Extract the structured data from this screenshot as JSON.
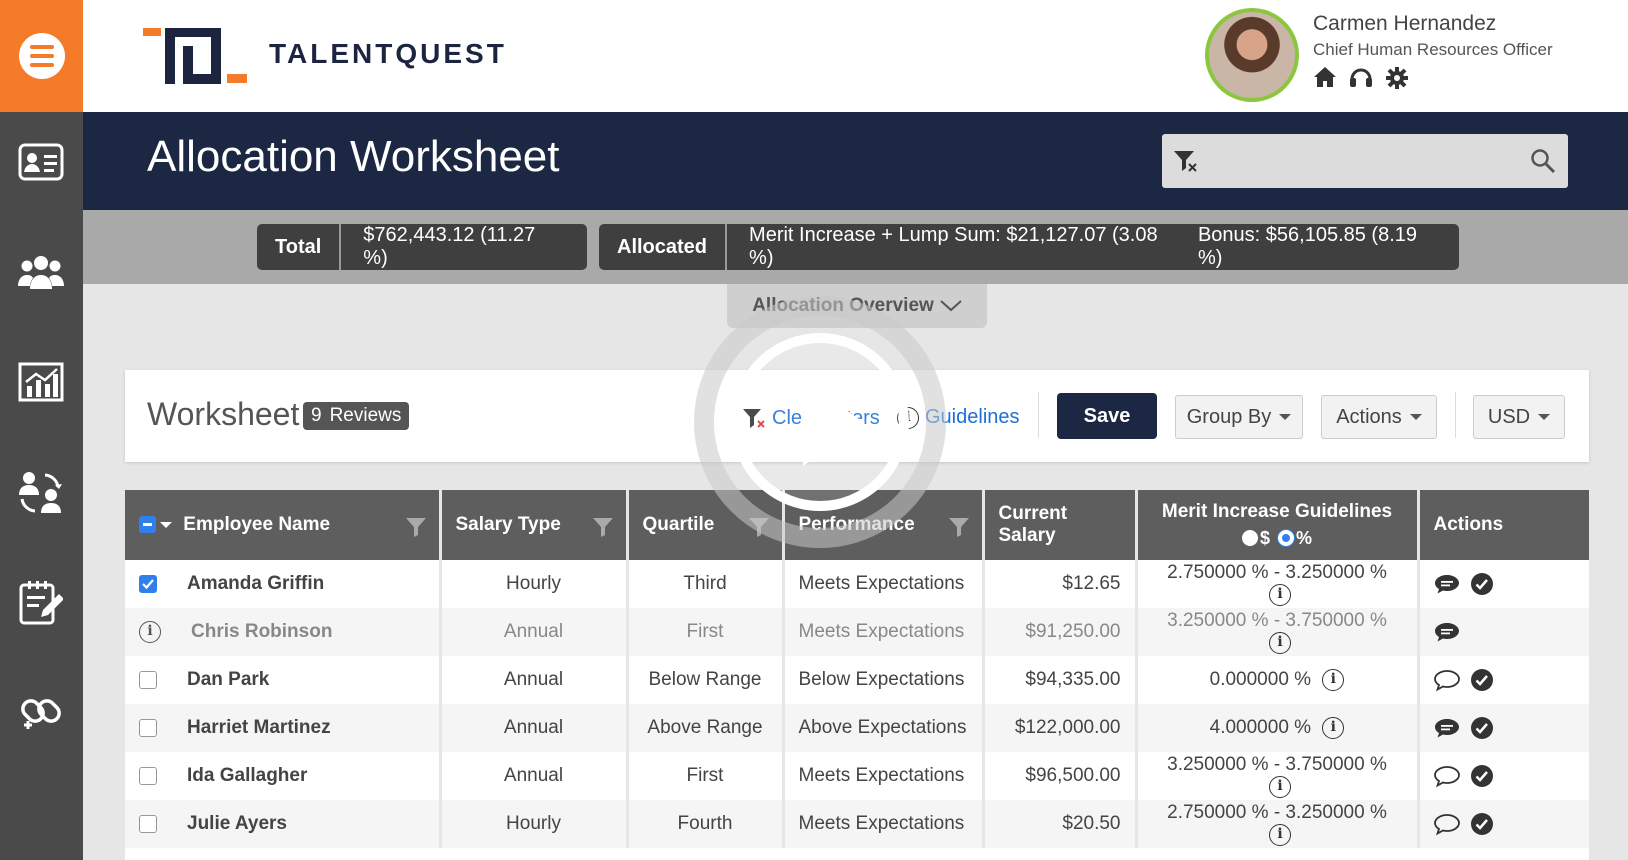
{
  "app": {
    "brand": "TALENTQUEST",
    "colors": {
      "brand_orange": "#f47b2a",
      "navy": "#1c2744",
      "link_blue": "#1e6fd9",
      "avatar_ring": "#8cc63f"
    }
  },
  "user": {
    "name": "Carmen Hernandez",
    "role": "Chief Human Resources Officer",
    "icons": [
      "home-icon",
      "headset-icon",
      "gear-icon"
    ]
  },
  "sidebar": {
    "items": [
      {
        "icon": "employee-card-icon"
      },
      {
        "icon": "people-group-icon"
      },
      {
        "icon": "chart-icon"
      },
      {
        "icon": "people-sync-icon"
      },
      {
        "icon": "edit-document-icon"
      },
      {
        "icon": "link-icon"
      }
    ]
  },
  "page": {
    "title": "Allocation Worksheet",
    "search_placeholder": ""
  },
  "summary": {
    "total_label": "Total",
    "total_value": "$762,443.12 (11.27 %)",
    "allocated_label": "Allocated",
    "merit_value": "Merit Increase + Lump Sum: $21,127.07 (3.08 %)",
    "bonus_value": "Bonus: $56,105.85 (8.19 %)",
    "overview_label": "Allocation Overview"
  },
  "worksheet": {
    "title": "Worksheet",
    "badge_count": "9",
    "badge_label": "Reviews",
    "clear_filters_label": "Clear Filters",
    "guidelines_label": "Guidelines",
    "save_label": "Save",
    "group_by_label": "Group By",
    "actions_label": "Actions",
    "currency_label": "USD"
  },
  "table": {
    "headers": {
      "employee_name": "Employee Name",
      "salary_type": "Salary Type",
      "quartile": "Quartile",
      "performance": "Performance",
      "current_salary": "Current Salary",
      "merit_guidelines": "Merit Increase Guidelines",
      "toggle_dollar": "$",
      "toggle_percent": "%",
      "actions": "Actions"
    },
    "rows": [
      {
        "name": "Amanda Griffin",
        "salary_type": "Hourly",
        "quartile": "Third",
        "performance": "Meets Expectations",
        "current_salary": "$12.65",
        "guideline": "2.750000 % - 3.250000 %",
        "selected": true,
        "comment_filled": true,
        "has_check": true,
        "dim": false
      },
      {
        "name": "Chris Robinson",
        "salary_type": "Annual",
        "quartile": "First",
        "performance": "Meets Expectations",
        "current_salary": "$91,250.00",
        "guideline": "3.250000 % - 3.750000 %",
        "selected": false,
        "comment_filled": true,
        "has_check": false,
        "dim": true
      },
      {
        "name": "Dan Park",
        "salary_type": "Annual",
        "quartile": "Below Range",
        "performance": "Below Expectations",
        "current_salary": "$94,335.00",
        "guideline": "0.000000 %",
        "selected": false,
        "comment_filled": false,
        "has_check": true,
        "dim": false
      },
      {
        "name": "Harriet Martinez",
        "salary_type": "Annual",
        "quartile": "Above Range",
        "performance": "Above Expectations",
        "current_salary": "$122,000.00",
        "guideline": "4.000000 %",
        "selected": false,
        "comment_filled": true,
        "has_check": true,
        "dim": false
      },
      {
        "name": "Ida Gallagher",
        "salary_type": "Annual",
        "quartile": "First",
        "performance": "Meets Expectations",
        "current_salary": "$96,500.00",
        "guideline": "3.250000 % - 3.750000 %",
        "selected": false,
        "comment_filled": false,
        "has_check": true,
        "dim": false
      },
      {
        "name": "Julie Ayers",
        "salary_type": "Hourly",
        "quartile": "Fourth",
        "performance": "Meets Expectations",
        "current_salary": "$20.50",
        "guideline": "2.750000 % - 3.250000 %",
        "selected": false,
        "comment_filled": false,
        "has_check": true,
        "dim": false
      }
    ]
  }
}
